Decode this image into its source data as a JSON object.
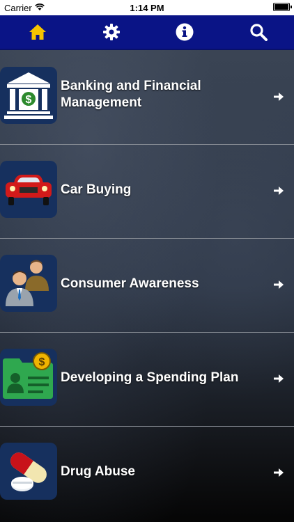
{
  "status_bar": {
    "carrier": "Carrier",
    "time": "1:14 PM"
  },
  "nav": {
    "items": [
      {
        "name": "home",
        "icon": "home-icon",
        "color": "#f5c400"
      },
      {
        "name": "settings",
        "icon": "gear-icon",
        "color": "#ffffff"
      },
      {
        "name": "info",
        "icon": "info-icon",
        "color": "#ffffff"
      },
      {
        "name": "search",
        "icon": "search-icon",
        "color": "#ffffff"
      }
    ]
  },
  "topics": [
    {
      "label": "Banking and Financial Management",
      "icon": "bank-icon"
    },
    {
      "label": "Car Buying",
      "icon": "car-icon"
    },
    {
      "label": "Consumer Awareness",
      "icon": "consumers-icon"
    },
    {
      "label": "Developing a Spending Plan",
      "icon": "id-card-dollar-icon"
    },
    {
      "label": "Drug Abuse",
      "icon": "pills-icon"
    }
  ],
  "colors": {
    "nav_background": "#0a1486",
    "active_icon": "#f5c400"
  }
}
